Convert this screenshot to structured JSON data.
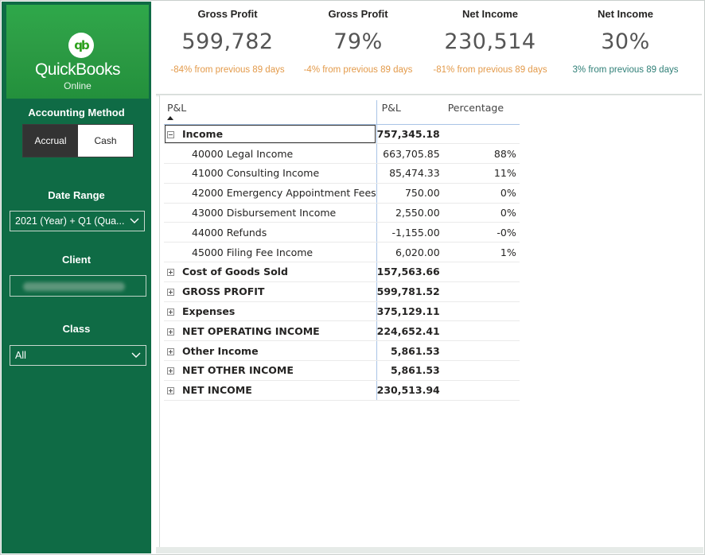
{
  "brand": {
    "mark": "qb",
    "name": "QuickBooks",
    "subtitle": "Online"
  },
  "filters": {
    "accounting_method": {
      "label": "Accounting Method",
      "options": [
        "Accrual",
        "Cash"
      ],
      "selected": "Accrual"
    },
    "date_range": {
      "label": "Date Range",
      "value": "2021 (Year) + Q1 (Qua..."
    },
    "client": {
      "label": "Client"
    },
    "class": {
      "label": "Class",
      "value": "All"
    }
  },
  "kpis": [
    {
      "title": "Gross Profit",
      "value": "599,782",
      "change": "-84% from previous 89 days",
      "change_color": "#e39a4a"
    },
    {
      "title": "Gross Profit",
      "value": "79%",
      "change": "-4% from previous 89 days",
      "change_color": "#e39a4a"
    },
    {
      "title": "Net Income",
      "value": "230,514",
      "change": "-81% from previous 89 days",
      "change_color": "#e39a4a"
    },
    {
      "title": "Net Income",
      "value": "30%",
      "change": "3% from previous 89 days",
      "change_color": "#2f7f77"
    }
  ],
  "table": {
    "headers": [
      "P&L",
      "P&L",
      "Percentage"
    ],
    "rows": [
      {
        "label": "Income",
        "value": "757,345.18",
        "pct": "",
        "type": "group",
        "expanded": true
      },
      {
        "label": "40000 Legal Income",
        "value": "663,705.85",
        "pct": "88%",
        "type": "child"
      },
      {
        "label": "41000 Consulting Income",
        "value": "85,474.33",
        "pct": "11%",
        "type": "child"
      },
      {
        "label": "42000 Emergency Appointment Fees",
        "value": "750.00",
        "pct": "0%",
        "type": "child"
      },
      {
        "label": "43000 Disbursement Income",
        "value": "2,550.00",
        "pct": "0%",
        "type": "child"
      },
      {
        "label": "44000 Refunds",
        "value": "-1,155.00",
        "pct": "-0%",
        "type": "child"
      },
      {
        "label": "45000 Filing Fee Income",
        "value": "6,020.00",
        "pct": "1%",
        "type": "child"
      },
      {
        "label": "Cost of Goods Sold",
        "value": "157,563.66",
        "pct": "",
        "type": "group"
      },
      {
        "label": "GROSS PROFIT",
        "value": "599,781.52",
        "pct": "",
        "type": "group"
      },
      {
        "label": "Expenses",
        "value": "375,129.11",
        "pct": "",
        "type": "group"
      },
      {
        "label": "NET OPERATING INCOME",
        "value": "224,652.41",
        "pct": "",
        "type": "group"
      },
      {
        "label": "Other Income",
        "value": "5,861.53",
        "pct": "",
        "type": "group"
      },
      {
        "label": "NET OTHER INCOME",
        "value": "5,861.53",
        "pct": "",
        "type": "group"
      },
      {
        "label": "NET INCOME",
        "value": "230,513.94",
        "pct": "",
        "type": "group"
      }
    ]
  }
}
